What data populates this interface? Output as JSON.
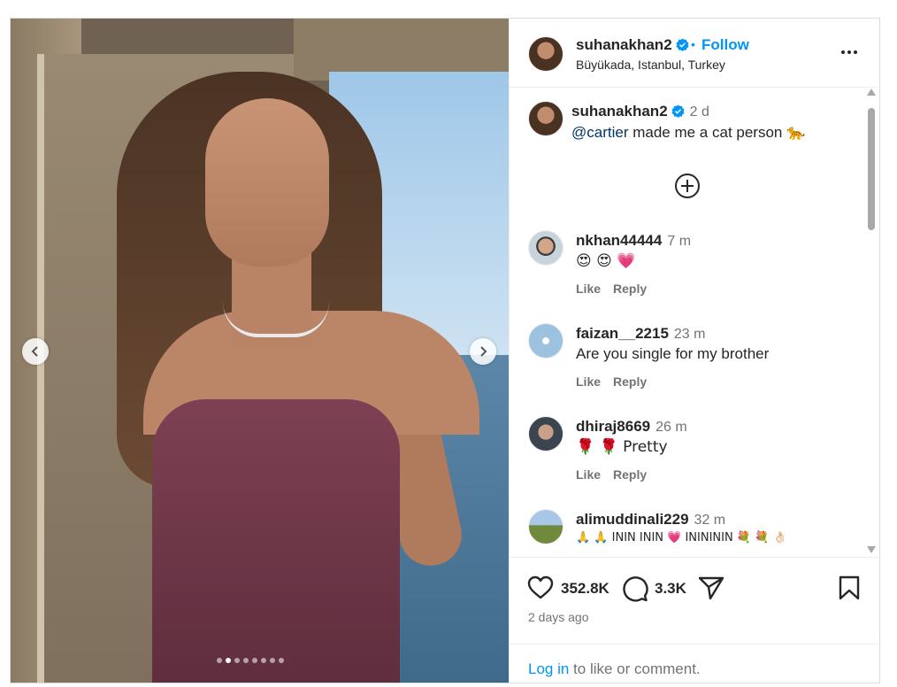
{
  "post": {
    "username": "suhanakhan2",
    "follow_label": "Follow",
    "separator": "•",
    "location": "Büyükada, Istanbul, Turkey",
    "carousel": {
      "total_slides": 8,
      "active_index": 1
    }
  },
  "caption": {
    "username": "suhanakhan2",
    "time": "2 d",
    "mention": "@cartier",
    "text": " made me a cat person",
    "emoji": "🐆"
  },
  "comments": [
    {
      "username": "nkhan44444",
      "time": "7 m",
      "text": "😍 😍 💗",
      "like": "Like",
      "reply": "Reply"
    },
    {
      "username": "faizan__2215",
      "time": "23 m",
      "text": "Are you single for my brother",
      "like": "Like",
      "reply": "Reply"
    },
    {
      "username": "dhiraj8669",
      "time": "26 m",
      "text": "🌹 🌹  Pretty",
      "like": "Like",
      "reply": "Reply"
    },
    {
      "username": "alimuddinali229",
      "time": "32 m",
      "text": "🙏 🙏 ININ ININ 💗 ININININ 💐 💐 👌🏻"
    }
  ],
  "stats": {
    "likes": "352.8K",
    "comments": "3.3K",
    "posted": "2 days ago"
  },
  "login": {
    "link": "Log in",
    "rest": " to like or comment."
  },
  "colors": {
    "accent": "#0095f6",
    "verified": "#0095f6",
    "muted": "#737373",
    "text": "#262626"
  }
}
